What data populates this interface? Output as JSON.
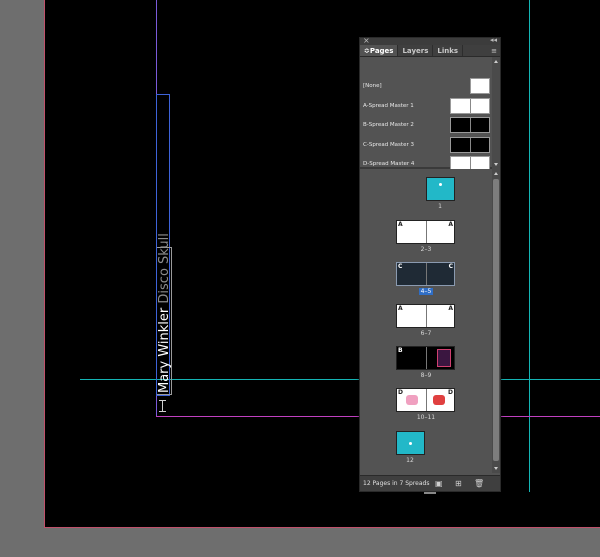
{
  "document": {
    "text_author": "Mary Winkler",
    "text_title": " Disco Skull"
  },
  "panel": {
    "close_glyph": "×",
    "collapse_glyph": "◂◂",
    "menu_glyph": "≡",
    "tabs": [
      {
        "label": "Pages",
        "active": true,
        "glyph": "≎"
      },
      {
        "label": "Layers",
        "active": false
      },
      {
        "label": "Links",
        "active": false
      }
    ],
    "masters": [
      {
        "label": "[None]",
        "thumb": "white",
        "single": true
      },
      {
        "label": "A-Spread Master 1",
        "thumb": "white",
        "single": false
      },
      {
        "label": "B-Spread Master 2",
        "thumb": "black",
        "single": false
      },
      {
        "label": "C-Spread Master 3",
        "thumb": "black",
        "single": false
      },
      {
        "label": "D-Spread Master 4",
        "thumb": "white",
        "single": false
      }
    ],
    "spreads": [
      {
        "label": "1",
        "style": "cyan",
        "single": true,
        "letters": [
          "",
          ""
        ],
        "selected": false
      },
      {
        "label": "2–3",
        "style": "white",
        "single": false,
        "letters": [
          "A",
          "A"
        ],
        "selected": false
      },
      {
        "label": "4–5",
        "style": "dark",
        "single": false,
        "letters": [
          "C",
          "C"
        ],
        "selected": true
      },
      {
        "label": "6–7",
        "style": "white",
        "single": false,
        "letters": [
          "A",
          "A"
        ],
        "selected": false
      },
      {
        "label": "8–9",
        "style": "black",
        "single": false,
        "letters": [
          "B",
          "B"
        ],
        "selected": false
      },
      {
        "label": "10–11",
        "style": "white",
        "single": false,
        "letters": [
          "D",
          "D"
        ],
        "selected": false
      },
      {
        "label": "12",
        "style": "cyan",
        "single": true,
        "letters": [
          "",
          ""
        ],
        "selected": false
      }
    ],
    "footer_status": "12 Pages in 7 Spreads",
    "footer_icons": {
      "edit_page_size": "▣",
      "new_page": "⊞",
      "delete_page": "🗑"
    }
  },
  "colors": {
    "pasteboard": "#6e6e6e",
    "page": "#000000",
    "guide_purple": "#7a5ad8",
    "guide_cyan": "#14b4b4",
    "guide_magenta": "#c040c0",
    "panel_bg": "#535353",
    "selection_blue": "#2f6ec6",
    "thumb_cyan": "#22b8c8"
  }
}
